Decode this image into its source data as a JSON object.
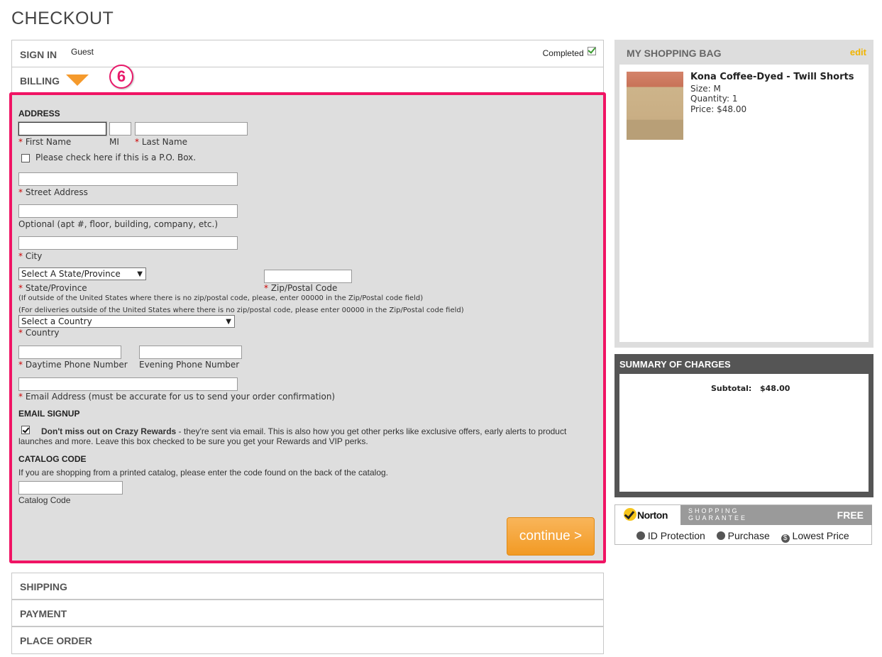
{
  "page": {
    "title": "CHECKOUT"
  },
  "steps": {
    "signin": {
      "label": "SIGN IN",
      "user": "Guest",
      "status": "Completed"
    },
    "billing": {
      "label": "BILLING",
      "step_badge": "6"
    },
    "shipping": {
      "label": "SHIPPING"
    },
    "payment": {
      "label": "PAYMENT"
    },
    "place_order": {
      "label": "PLACE ORDER"
    }
  },
  "billing_form": {
    "address_header": "ADDRESS",
    "first_name": {
      "label": "First Name",
      "value": ""
    },
    "mi": {
      "label": "MI",
      "value": ""
    },
    "last_name": {
      "label": "Last Name",
      "value": ""
    },
    "po_box": {
      "label": "Please check here if this is a P.O. Box.",
      "checked": false
    },
    "street": {
      "label": "Street Address",
      "value": ""
    },
    "optional": {
      "label": "Optional (apt #, floor, building, company, etc.)",
      "value": ""
    },
    "city": {
      "label": "City",
      "value": ""
    },
    "state": {
      "label": "State/Province",
      "selected": "Select A State/Province"
    },
    "zip": {
      "label": "Zip/Postal Code",
      "value": ""
    },
    "zip_note": "(If outside of the United States where there is no zip/postal code, please, enter 00000 in the Zip/Postal code field)",
    "country_note": "(For deliveries outside of the United States where there is no zip/postal code, please enter 00000 in the Zip/Postal code field)",
    "country": {
      "label": "Country",
      "selected": "Select a Country"
    },
    "day_phone": {
      "label": "Daytime Phone Number",
      "value": ""
    },
    "eve_phone": {
      "label": "Evening Phone Number",
      "value": ""
    },
    "email": {
      "label": "Email Address (must be accurate for us to send your order confirmation)",
      "value": ""
    },
    "email_signup_header": "EMAIL SIGNUP",
    "email_signup": {
      "checked": true,
      "bold": "Don't miss out on Crazy Rewards",
      "text": " - they're sent via email. This is also how you get other perks like exclusive offers, early alerts to product launches and more. Leave this box checked to be sure you get your Rewards and VIP perks."
    },
    "catalog_header": "CATALOG CODE",
    "catalog_note": "If you are shopping from a printed catalog, please enter the code found on the back of the catalog.",
    "catalog_code": {
      "label": "Catalog Code",
      "value": ""
    },
    "continue_label": "continue >"
  },
  "bag": {
    "title": "MY SHOPPING BAG",
    "edit": "edit",
    "item": {
      "name": "Kona Coffee-Dyed - Twill Shorts",
      "size": "Size: M",
      "quantity": "Quantity: 1",
      "price": "Price: $48.00"
    }
  },
  "summary": {
    "title": "SUMMARY OF CHARGES",
    "subtotal_label": "Subtotal:",
    "subtotal_value": "$48.00"
  },
  "norton": {
    "brand": "Norton",
    "guarantee": "SHOPPING GUARANTEE",
    "free": "FREE",
    "features": [
      "ID Protection",
      "Purchase",
      "Lowest Price"
    ]
  },
  "colors": {
    "accent_orange": "#f59a2c",
    "highlight_pink": "#f01464",
    "summary_gray": "#555555"
  }
}
